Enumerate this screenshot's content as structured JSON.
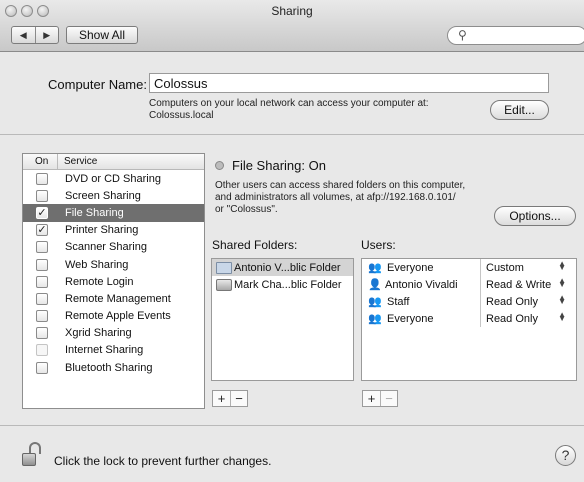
{
  "window": {
    "title": "Sharing"
  },
  "toolbar": {
    "back_glyph": "◀",
    "forward_glyph": "▶",
    "show_all": "Show All",
    "search_placeholder": ""
  },
  "computer": {
    "label": "Computer Name:",
    "name": "Colossus",
    "desc_line1": "Computers on your local network can access your computer at:",
    "desc_line2": "Colossus.local",
    "edit_label": "Edit..."
  },
  "services": {
    "col_on": "On",
    "col_service": "Service",
    "items": [
      {
        "label": "DVD or CD Sharing",
        "checked": false
      },
      {
        "label": "Screen Sharing",
        "checked": false
      },
      {
        "label": "File Sharing",
        "checked": true,
        "selected": true
      },
      {
        "label": "Printer Sharing",
        "checked": true
      },
      {
        "label": "Scanner Sharing",
        "checked": false
      },
      {
        "label": "Web Sharing",
        "checked": false
      },
      {
        "label": "Remote Login",
        "checked": false
      },
      {
        "label": "Remote Management",
        "checked": false
      },
      {
        "label": "Remote Apple Events",
        "checked": false
      },
      {
        "label": "Xgrid Sharing",
        "checked": false
      },
      {
        "label": "Internet Sharing",
        "checked": false,
        "disabled": true
      },
      {
        "label": "Bluetooth Sharing",
        "checked": false
      }
    ]
  },
  "detail": {
    "status": "File Sharing: On",
    "info_line1": "Other users can access shared folders on this computer,",
    "info_line2": "and administrators all volumes, at afp://192.168.0.101/",
    "info_line3": "or \"Colossus\".",
    "options_label": "Options...",
    "shared_folders_label": "Shared Folders:",
    "users_label": "Users:",
    "folders": [
      {
        "name": "Antonio V...blic Folder",
        "icon": "folder-icon",
        "selected": true
      },
      {
        "name": "Mark Cha...blic Folder",
        "icon": "drive-icon",
        "selected": false
      }
    ],
    "users": [
      {
        "name": "Everyone",
        "icon": "group-icon",
        "permission": "Custom"
      },
      {
        "name": "Antonio Vivaldi",
        "icon": "person-icon",
        "permission": "Read & Write"
      },
      {
        "name": "Staff",
        "icon": "group-icon",
        "permission": "Read Only"
      },
      {
        "name": "Everyone",
        "icon": "group-icon",
        "permission": "Read Only"
      }
    ],
    "add_glyph": "+",
    "remove_glyph": "−"
  },
  "footer": {
    "lock_text": "Click the lock to prevent further changes.",
    "help_glyph": "?"
  }
}
